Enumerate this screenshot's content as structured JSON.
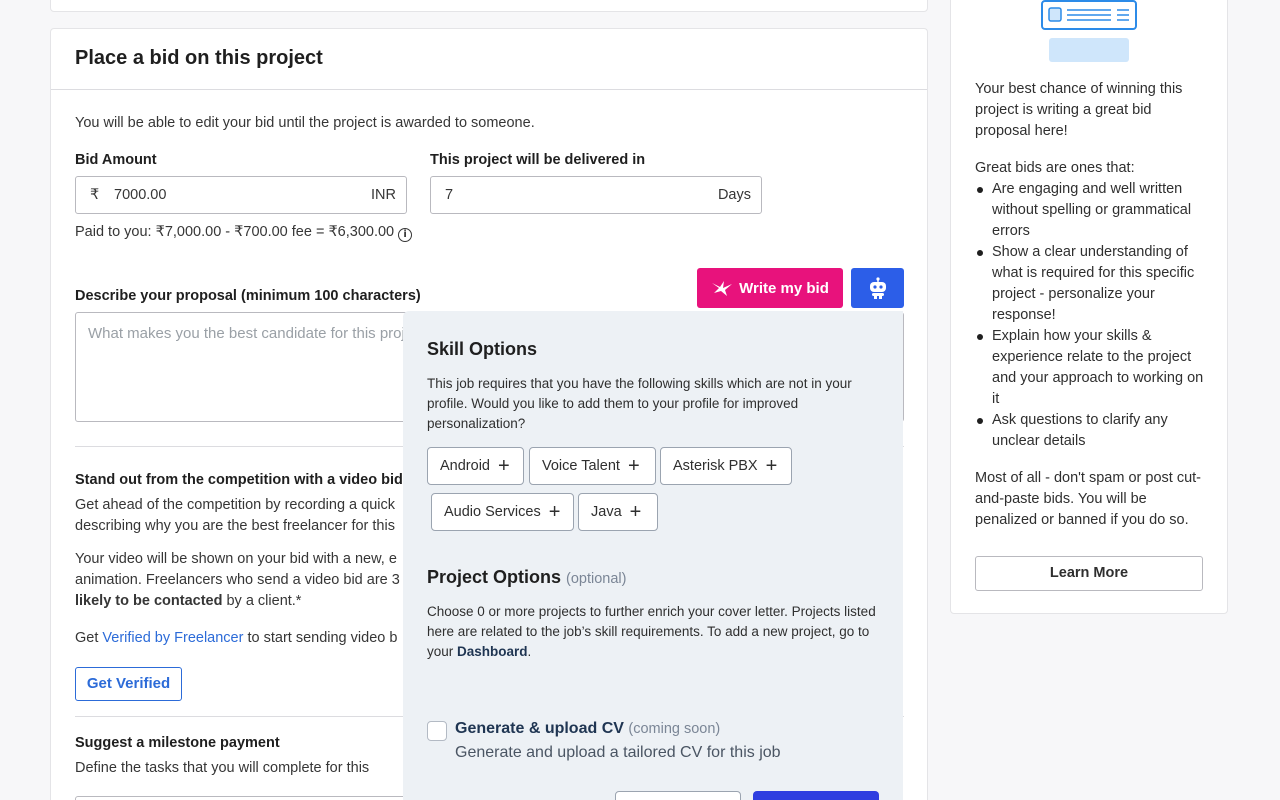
{
  "bid_form": {
    "title": "Place a bid on this project",
    "edit_note": "You will be able to edit your bid until the project is awarded to someone.",
    "bid_amount_label": "Bid Amount",
    "currency_symbol": "₹",
    "bid_amount_value": "7000.00",
    "currency_code": "INR",
    "delivery_label": "This project will be delivered in",
    "delivery_value": "7",
    "delivery_unit": "Days",
    "paid_note": "Paid to you: ₹7,000.00 - ₹700.00 fee = ₹6,300.00",
    "info_glyph": "i",
    "proposal_label": "Describe your proposal (minimum 100 characters)",
    "proposal_placeholder": "What makes you the best candidate for this proj",
    "write_bid_label": "Write my bid",
    "video_heading": "Stand out from the competition with a video bid",
    "video_text_1a": "Get ahead of the competition by recording a quick",
    "video_text_1b": "describing why you are the best freelancer for this",
    "video_text_2a": "Your video will be shown on your bid with a new, e",
    "video_text_2b": "animation. Freelancers who send a video bid are 3",
    "video_text_2c": "likely to be contacted",
    "video_text_2d": " by a client.*",
    "verify_prefix": "Get ",
    "verify_link": "Verified by Freelancer",
    "verify_suffix": " to start sending video b",
    "get_verified_label": "Get Verified",
    "milestone_heading": "Suggest a milestone payment",
    "milestone_text": "Define the tasks that you will complete for this"
  },
  "popover": {
    "skill_title": "Skill Options",
    "skill_text": "This job requires that you have the following skills which are not in your profile. Would you like to add them to your profile for improved personalization?",
    "skills": [
      "Android",
      "Voice Talent",
      "Asterisk PBX",
      "Audio Services",
      "Java"
    ],
    "plus_glyph": "+",
    "project_title": "Project Options",
    "project_optional": "(optional)",
    "project_text": "Choose 0 or more projects to further enrich your cover letter. Projects listed here are related to the job’s skill requirements. To add a new project, go to your",
    "dashboard_link": "Dashboard",
    "period": ".",
    "cv_title": "Generate & upload CV",
    "cv_soon": "(coming soon)",
    "cv_desc": "Generate and upload a tailored CV for this job"
  },
  "sidebar": {
    "intro": "Your best chance of winning this project is writing a great bid proposal here!",
    "great_bids": "Great bids are ones that:",
    "tips": [
      "Are engaging and well written without spelling or grammatical errors",
      "Show a clear understanding of what is required for this specific project - personalize your response!",
      "Explain how your skills & experience relate to the project and your approach to working on it",
      "Ask questions to clarify any unclear details"
    ],
    "warning": "Most of all - don't spam or post cut-and-paste bids. You will be penalized or banned if you do so.",
    "learn_more": "Learn More"
  },
  "colors": {
    "write_bid_button": "#e8127c",
    "bot_button": "#2c5ee8",
    "link": "#2c6bd8",
    "popover_bg": "#edf1f5",
    "primary_popover_button": "#2f3ee0"
  },
  "icons": {
    "write_bid": "bird-icon",
    "bot": "robot-icon",
    "info": "info-icon",
    "chip_add": "plus-icon"
  }
}
